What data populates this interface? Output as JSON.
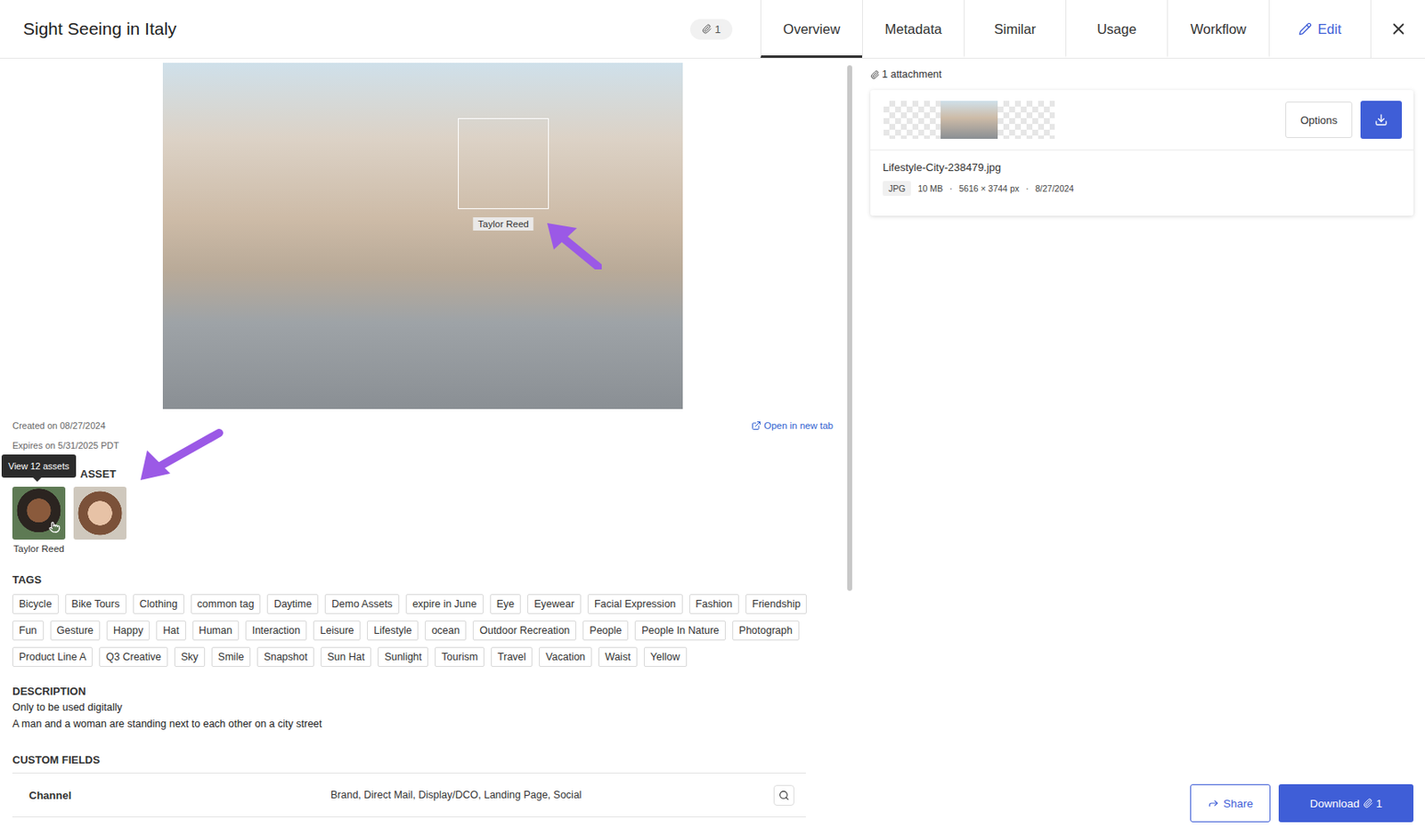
{
  "header": {
    "title": "Sight Seeing in Italy",
    "attachment_count": "1"
  },
  "tabs": [
    {
      "label": "Overview",
      "selected": true,
      "kind": "view"
    },
    {
      "label": "Metadata",
      "selected": false,
      "kind": "view"
    },
    {
      "label": "Similar",
      "selected": false,
      "kind": "view"
    },
    {
      "label": "Usage",
      "selected": false,
      "kind": "view"
    },
    {
      "label": "Workflow",
      "selected": false,
      "kind": "view"
    },
    {
      "label": "Edit",
      "selected": false,
      "kind": "action"
    }
  ],
  "photo": {
    "face_label": "Taylor Reed"
  },
  "meta": {
    "created": "Created on 08/27/2024",
    "expires": "Expires on 5/31/2025 PDT",
    "open_link": "Open in new tab"
  },
  "people": {
    "heading": "ASSET",
    "tooltip": "View 12 assets",
    "items": [
      {
        "label": "Taylor Reed",
        "hovered": true
      },
      {
        "label": "",
        "hovered": false
      }
    ]
  },
  "tags": {
    "heading": "TAGS",
    "items": [
      "Bicycle",
      "Bike Tours",
      "Clothing",
      "common tag",
      "Daytime",
      "Demo Assets",
      "expire in June",
      "Eye",
      "Eyewear",
      "Facial Expression",
      "Fashion",
      "Friendship",
      "Fun",
      "Gesture",
      "Happy",
      "Hat",
      "Human",
      "Interaction",
      "Leisure",
      "Lifestyle",
      "ocean",
      "Outdoor Recreation",
      "People",
      "People In Nature",
      "Photograph",
      "Product Line A",
      "Q3 Creative",
      "Sky",
      "Smile",
      "Snapshot",
      "Sun Hat",
      "Sunlight",
      "Tourism",
      "Travel",
      "Vacation",
      "Waist",
      "Yellow"
    ]
  },
  "description": {
    "heading": "DESCRIPTION",
    "lines": [
      "Only to be used digitally",
      "A man and a woman are standing next to each other on a city street"
    ]
  },
  "custom_fields": {
    "heading": "CUSTOM FIELDS",
    "rows": [
      {
        "name": "Channel",
        "value": "Brand, Direct Mail, Display/DCO, Landing Page, Social"
      }
    ]
  },
  "attachments": {
    "summary": "1 attachment",
    "items": [
      {
        "filename": "Lifestyle-City-238479.jpg",
        "type": "JPG",
        "size": "10 MB",
        "dimensions": "5616 × 3744 px",
        "date": "8/27/2024",
        "options": "Options",
        "separator": "·"
      }
    ]
  },
  "actions": {
    "share": "Share",
    "download": "Download",
    "download_count": "1"
  }
}
